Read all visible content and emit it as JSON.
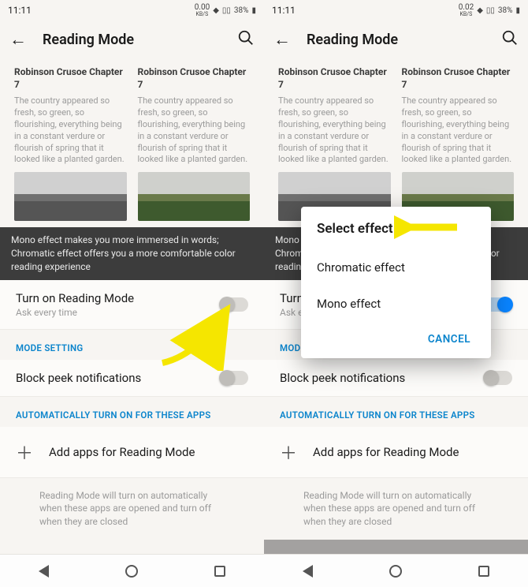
{
  "left": {
    "status": {
      "time": "11:11",
      "net": "0.00",
      "netunit": "KB/S",
      "battery": "38%"
    },
    "header": {
      "title": "Reading Mode"
    },
    "previews": [
      {
        "title": "Robinson Crusoe Chapter 7",
        "text": "The country appeared so fresh, so green, so flourishing, everything being in a constant verdure or flourish of spring that it looked like a planted garden."
      },
      {
        "title": "Robinson Crusoe Chapter 7",
        "text": "The country appeared so fresh, so green, so flourishing, everything being in a constant verdure or flourish of spring that it looked like a planted garden."
      }
    ],
    "banner": "Mono effect makes you more immersed in words; Chromatic effect offers you a more comfortable color reading experience",
    "toggle_row": {
      "label": "Turn on Reading Mode",
      "sub": "Ask every time"
    },
    "sections": {
      "mode": "MODE SETTING",
      "auto": "AUTOMATICALLY TURN ON FOR THESE APPS"
    },
    "block_row": {
      "label": "Block peek notifications"
    },
    "add_row": {
      "label": "Add apps for Reading Mode"
    },
    "note": "Reading Mode will turn on automatically when these apps are opened and turn off when they are closed"
  },
  "right": {
    "status": {
      "time": "11:11",
      "net": "0.02",
      "netunit": "KB/S",
      "battery": "38%"
    },
    "header": {
      "title": "Reading Mode"
    },
    "previews": [
      {
        "title": "Robinson Crusoe Chapter 7",
        "text": "The country appeared so fresh, so green, so flourishing, everything being in a constant verdure or flourish of spring that it looked like a planted garden."
      },
      {
        "title": "Robinson Crusoe Chapter 7",
        "text": "The country appeared so fresh, so green, so flourishing, everything being in a constant verdure or flourish of spring that it looked like a planted garden."
      }
    ],
    "banner": "Mono effect makes you more immersed in words; Chromatic effect offers you a more comfortable color reading experience",
    "toggle_row": {
      "label": "Turn on Reading Mode",
      "sub": "Ask every time"
    },
    "sections": {
      "mode": "MODE SETTING",
      "auto": "AUTOMATICALLY TURN ON FOR THESE APPS"
    },
    "block_row": {
      "label": "Block peek notifications"
    },
    "add_row": {
      "label": "Add apps for Reading Mode"
    },
    "note": "Reading Mode will turn on automatically when these apps are opened and turn off when they are closed",
    "dialog": {
      "title": "Select effect",
      "option1": "Chromatic effect",
      "option2": "Mono effect",
      "cancel": "CANCEL"
    }
  }
}
